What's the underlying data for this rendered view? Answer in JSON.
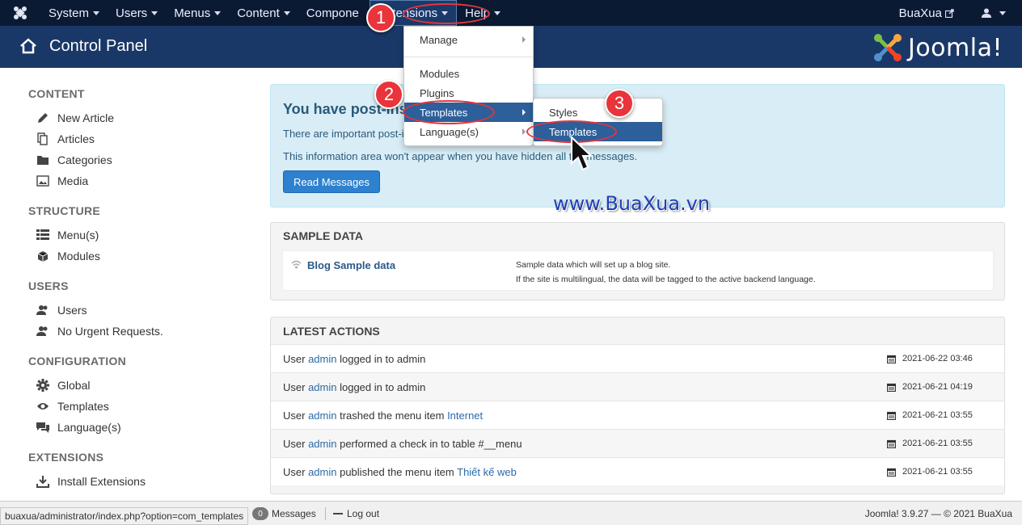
{
  "nav": {
    "items": [
      "System",
      "Users",
      "Menus",
      "Content",
      "Compone",
      "Extensions",
      "Help"
    ],
    "user_link": "BuaXua"
  },
  "header": {
    "title": "Control Panel",
    "brand": "Joomla!"
  },
  "sidebar": {
    "sections": [
      {
        "heading": "CONTENT",
        "items": [
          "New Article",
          "Articles",
          "Categories",
          "Media"
        ]
      },
      {
        "heading": "STRUCTURE",
        "items": [
          "Menu(s)",
          "Modules"
        ]
      },
      {
        "heading": "USERS",
        "items": [
          "Users",
          "No Urgent Requests."
        ]
      },
      {
        "heading": "CONFIGURATION",
        "items": [
          "Global",
          "Templates",
          "Language(s)"
        ]
      },
      {
        "heading": "EXTENSIONS",
        "items": [
          "Install Extensions"
        ]
      }
    ]
  },
  "alert": {
    "title": "You have post-ins",
    "line1": "There are important post-i",
    "line2": "This information area won't appear when you have hidden all t",
    "line2_end": "messages.",
    "button": "Read Messages"
  },
  "watermark": "www.BuaXua.vn",
  "sample_data": {
    "heading": "SAMPLE DATA",
    "name": "Blog Sample data",
    "desc1": "Sample data which will set up a blog site.",
    "desc2": "If the site is multilingual, the data will be tagged to the active backend language."
  },
  "latest_actions": {
    "heading": "LATEST ACTIONS",
    "rows": [
      {
        "pre": "User ",
        "user": "admin",
        "mid": " logged in to admin",
        "link": "",
        "date": "2021-06-22 03:46"
      },
      {
        "pre": "User ",
        "user": "admin",
        "mid": " logged in to admin",
        "link": "",
        "date": "2021-06-21 04:19"
      },
      {
        "pre": "User ",
        "user": "admin",
        "mid": " trashed the menu item ",
        "link": "Internet",
        "date": "2021-06-21 03:55"
      },
      {
        "pre": "User ",
        "user": "admin",
        "mid": " performed a check in to table #__menu",
        "link": "",
        "date": "2021-06-21 03:55"
      },
      {
        "pre": "User ",
        "user": "admin",
        "mid": " published the menu item ",
        "link": "Thiết kế web",
        "date": "2021-06-21 03:55"
      }
    ]
  },
  "extensions_menu": {
    "items": [
      "Manage",
      "Modules",
      "Plugins",
      "Templates",
      "Language(s)"
    ]
  },
  "templates_submenu": {
    "items": [
      "Styles",
      "Templates"
    ]
  },
  "annotations": [
    "1",
    "2",
    "3"
  ],
  "status": {
    "url": "buaxua/administrator/index.php?option=com_templates",
    "messages_count": "0",
    "messages_label": "Messages",
    "logout": "Log out",
    "footer": "Joomla! 3.9.27  —  © 2021 BuaXua"
  },
  "colors": {
    "navbar": "#0b1a33",
    "header": "#1a3867",
    "selected": "#2d5f9a",
    "annotation": "#e8343a"
  }
}
